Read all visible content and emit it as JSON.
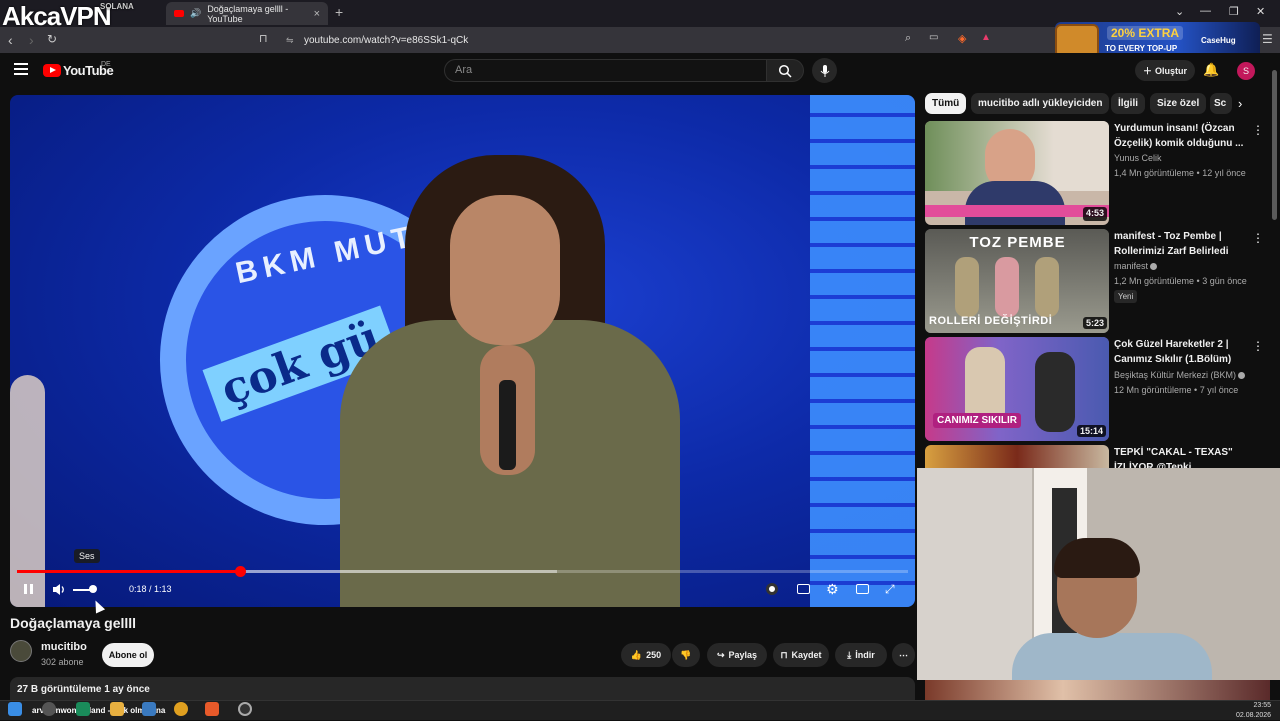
{
  "overlay": {
    "watermark": "AkcaVPN",
    "watermark_small": "SOLANA"
  },
  "browser": {
    "tab_title": "Doğaçlamaya gellll - YouTube",
    "url": "youtube.com/watch?v=e86SSk1-qCk",
    "promo": {
      "headline": "20% EXTRA",
      "sub": "TO EVERY TOP-UP",
      "brand": "CaseHug"
    }
  },
  "youtube": {
    "logo_text": "YouTube",
    "region": "DE",
    "search_placeholder": "Ara",
    "create_label": "Oluştur",
    "avatar_letter": "S"
  },
  "player": {
    "tooltip": "Ses",
    "current_time": "0:18",
    "duration": "1:13",
    "time_display": "0:18 / 1:13",
    "progress": 0.25,
    "volume": 0.8,
    "video_text": {
      "bkm": "BKM MUT",
      "cok": "çok gü"
    }
  },
  "video": {
    "title": "Doğaçlamaya gellll",
    "channel": "mucitibo",
    "subscribers": "302 abone",
    "subscribe_label": "Abone ol",
    "likes": "250",
    "share_label": "Paylaş",
    "save_label": "Kaydet",
    "download_label": "İndir",
    "description_header": "27 B görüntüleme  1 ay önce"
  },
  "sidebar": {
    "chips": [
      "Tümü",
      "mucitibo adlı yükleyiciden",
      "İlgili",
      "Size özel",
      "Sc"
    ],
    "recommendations": [
      {
        "title": "Yurdumun insanı! (Özcan Özçelik) komik olduğunu ...",
        "channel": "Yunus Celik",
        "meta": "1,4 Mn görüntüleme • 12 yıl önce",
        "duration": "4:53",
        "thumb_color": "#c9b7a8",
        "badge": ""
      },
      {
        "title": "manifest - Toz Pembe | Rollerimizi Zarf Belirledi",
        "channel": "manifest",
        "meta": "1,2 Mn görüntüleme • 3 gün önce",
        "duration": "5:23",
        "thumb_color": "#7a7a72",
        "badge": "Yeni",
        "thumb_top": "TOZ PEMBE",
        "thumb_bottom": "ROLLERİ DEĞİŞTİRDİ"
      },
      {
        "title": "Çok Güzel Hareketler 2 | Canımız Sıkılır (1.Bölüm)",
        "channel": "Beşiktaş Kültür Merkezi (BKM)",
        "meta": "12 Mn görüntüleme • 7 yıl önce",
        "duration": "15:14",
        "thumb_color": "#7f5aa8",
        "badge": "",
        "thumb_caption": "CANIMIZ SIKILIR"
      },
      {
        "title": "TEPKİ \"CAKAL - TEXAS\" İZLİYOR @Tepki",
        "channel": "",
        "meta": "",
        "duration": "",
        "thumb_color": "#8a3b2a",
        "badge": ""
      }
    ]
  },
  "taskbar": {
    "now_playing": "arvenInwonderland - aşık olm bana",
    "time": "23:55",
    "date": "02.08.2026"
  }
}
